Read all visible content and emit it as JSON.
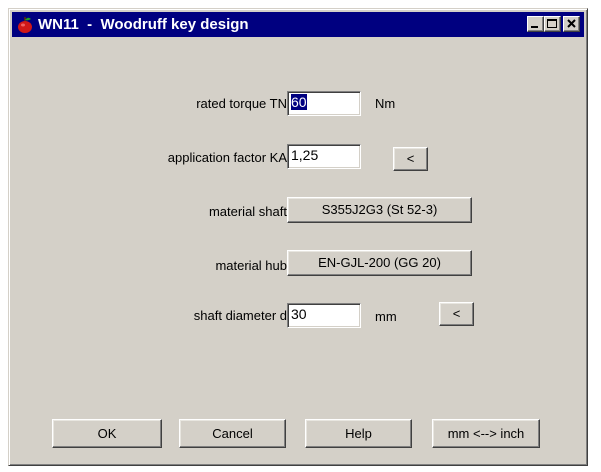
{
  "window": {
    "title": "WN11  -  Woodruff key design"
  },
  "titlebar_buttons": {
    "minimize_icon": "minimize-icon",
    "maximize_icon": "maximize-icon",
    "close_icon": "close-icon"
  },
  "form": {
    "rated_torque": {
      "label": "rated torque TN",
      "value": "60",
      "unit": "Nm"
    },
    "application_factor": {
      "label": "application factor KA",
      "value": "1,25",
      "button_label": "<"
    },
    "material_shaft": {
      "label": "material shaft",
      "button_label": "S355J2G3 (St 52-3)"
    },
    "material_hub": {
      "label": "material hub",
      "button_label": "EN-GJL-200 (GG 20)"
    },
    "shaft_diameter": {
      "label": "shaft diameter d",
      "value": "30",
      "unit": "mm",
      "button_label": "<"
    }
  },
  "footer": {
    "ok_label": "OK",
    "cancel_label": "Cancel",
    "help_label": "Help",
    "units_label": "mm <--> inch"
  },
  "colors": {
    "titlebar": "#000080",
    "dialog_face": "#d4d0c8",
    "selection": "#000080"
  }
}
